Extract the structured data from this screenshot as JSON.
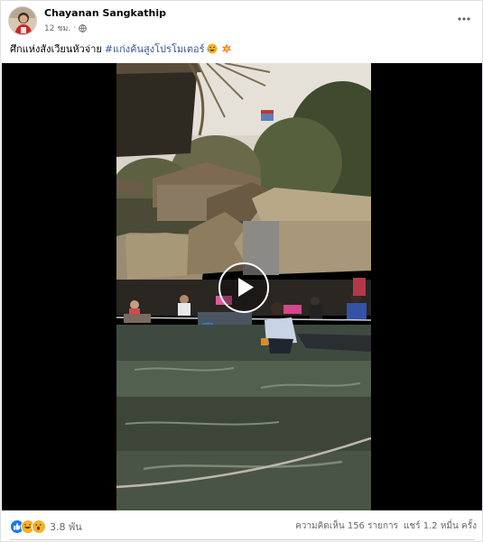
{
  "post": {
    "author": "Chayanan Sangkathip",
    "time": "12 ชม.",
    "caption_text": "ศึกแห่งสังเวียนหัวจ่าย",
    "hashtag": "#แก่งค้นสูงโปรโมเตอร์",
    "icons": {
      "privacy": "globe-icon",
      "more": "more-options-icon",
      "emoji1": "laughing-emoji-icon",
      "emoji2": "collision-emoji-icon",
      "play": "play-icon"
    }
  },
  "video": {
    "state": "paused"
  },
  "footer": {
    "reaction_count": "3.8 พัน",
    "reactions": [
      "like",
      "haha",
      "wow"
    ],
    "comments": "ความคิดเห็น 156 รายการ",
    "shares": "แชร์ 1.2 หมื่น ครั้ง"
  },
  "colors": {
    "link": "#385898",
    "secondary_text": "#65676b",
    "like": "#1877f2",
    "haha": "#f7b125"
  }
}
